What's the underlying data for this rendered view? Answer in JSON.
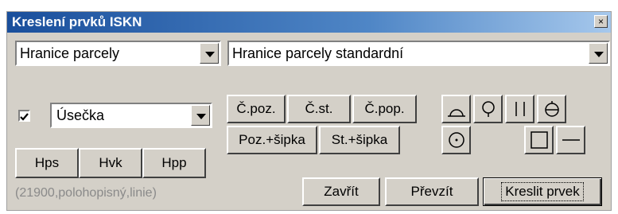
{
  "window": {
    "title": "Kreslení prvků ISKN",
    "close_label": "×"
  },
  "combo_layer": {
    "value": "Hranice parcely"
  },
  "combo_style": {
    "value": "Hranice parcely standardní"
  },
  "combo_type": {
    "value": "Úsečka",
    "checked": true
  },
  "label_buttons": {
    "cpoz": "Č.poz.",
    "cst": "Č.st.",
    "cpop": "Č.pop.",
    "poz_sipka": "Poz.+šipka",
    "st_sipka": "St.+šipka"
  },
  "mode_buttons": {
    "hps": "Hps",
    "hvk": "Hvk",
    "hpp": "Hpp"
  },
  "action_buttons": {
    "close": "Zavřít",
    "take": "Převzít",
    "draw": "Kreslit prvek"
  },
  "status": "(21900,polohopisný,linie)",
  "icons": [
    "arc-bottom-icon",
    "arc-top-icon",
    "two-lines-icon",
    "circle-line-icon",
    "circle-dot-icon",
    "square-icon",
    "dash-icon"
  ]
}
